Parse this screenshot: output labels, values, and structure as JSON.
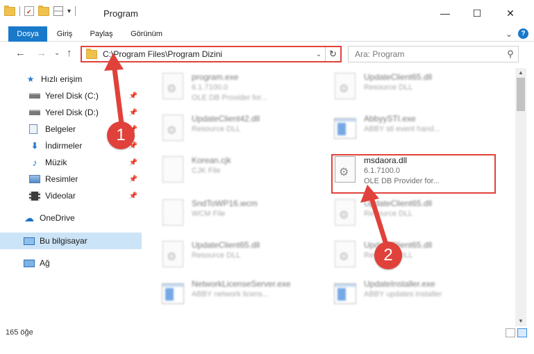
{
  "window": {
    "title": "Program",
    "minimize": "—",
    "maximize": "☐",
    "close": "✕"
  },
  "ribbon": {
    "tabs": [
      "Dosya",
      "Giriş",
      "Paylaş",
      "Görünüm"
    ],
    "expand": "⌄",
    "help": "?"
  },
  "nav": {
    "back": "←",
    "forward": "→",
    "recent": "⌄",
    "up": "↑",
    "address": "C:\\Program Files\\Program Dizini",
    "address_dropdown": "⌄",
    "refresh": "↻",
    "search_placeholder": "Ara: Program",
    "search_icon": "search-icon"
  },
  "sidebar": {
    "items": [
      {
        "label": "Hızlı erişim",
        "icon": "star-icon",
        "pinned": false
      },
      {
        "label": "Yerel Disk (C:)",
        "icon": "drive-icon",
        "pinned": true
      },
      {
        "label": "Yerel Disk (D:)",
        "icon": "drive-icon",
        "pinned": true
      },
      {
        "label": "Belgeler",
        "icon": "documents-icon",
        "pinned": true
      },
      {
        "label": "İndirmeler",
        "icon": "download-icon",
        "pinned": true
      },
      {
        "label": "Müzik",
        "icon": "music-icon",
        "pinned": true
      },
      {
        "label": "Resimler",
        "icon": "pictures-icon",
        "pinned": true
      },
      {
        "label": "Videolar",
        "icon": "video-icon",
        "pinned": true
      },
      {
        "label": "OneDrive",
        "icon": "cloud-icon",
        "pinned": false
      },
      {
        "label": "Bu bilgisayar",
        "icon": "computer-icon",
        "pinned": false,
        "selected": true
      },
      {
        "label": "Ağ",
        "icon": "network-icon",
        "pinned": false
      }
    ]
  },
  "files": [
    {
      "name": "program.exe",
      "line2": "6.1.7100.0",
      "line3": "OLE DB Provider for...",
      "icon": "app-icon"
    },
    {
      "name": "UpdateClient65.dll",
      "line2": "Resource DLL",
      "line3": "",
      "icon": "dll-icon"
    },
    {
      "name": "UpdateClient42.dll",
      "line2": "Resource DLL",
      "line3": "",
      "icon": "dll-icon"
    },
    {
      "name": "AbbyySTI.exe",
      "line2": "ABBY sti event hand...",
      "line3": "",
      "icon": "app-icon"
    },
    {
      "name": "Korean.cjk",
      "line2": "CJK File",
      "line3": "",
      "icon": "file-icon"
    },
    {
      "name": "msdaora.dll",
      "line2": "6.1.7100.0",
      "line3": "OLE DB Provider for...",
      "icon": "dll-icon",
      "highlighted": true
    },
    {
      "name": "SndToWP16.wcm",
      "line2": "WCM File",
      "line3": "",
      "icon": "file-icon"
    },
    {
      "name": "UpdateClient65.dll",
      "line2": "Resource DLL",
      "line3": "",
      "icon": "dll-icon"
    },
    {
      "name": "UpdateClient65.dll",
      "line2": "Resource DLL",
      "line3": "",
      "icon": "dll-icon"
    },
    {
      "name": "UpdateClient65.dll",
      "line2": "Resource DLL",
      "line3": "",
      "icon": "dll-icon"
    },
    {
      "name": "NetworkLicenseServer.exe",
      "line2": "ABBY network licens...",
      "line3": "",
      "icon": "app-icon"
    },
    {
      "name": "UpdateInstaller.exe",
      "line2": "ABBY updates installer",
      "line3": "",
      "icon": "app-icon"
    }
  ],
  "status": {
    "count": "165 öğe"
  },
  "annotations": {
    "step1": "1",
    "step2": "2",
    "color": "#e0413a"
  }
}
